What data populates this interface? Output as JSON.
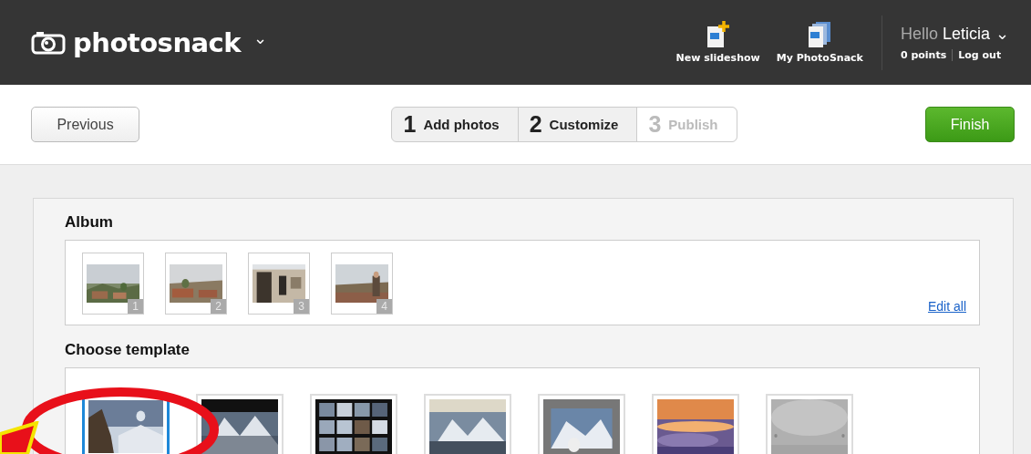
{
  "header": {
    "logo": "photosnack",
    "logo_caret": "⌄",
    "actions": [
      {
        "label": "New slideshow",
        "kind": "new"
      },
      {
        "label": "My PhotoSnack",
        "kind": "stack"
      }
    ],
    "greeting": "Hello",
    "user": "Leticia",
    "user_caret": "⌄",
    "points": "0 points",
    "logout": "Log out"
  },
  "toolbar": {
    "previous": "Previous",
    "finish": "Finish",
    "steps": [
      {
        "number": "1",
        "label": "Add photos",
        "disabled": false
      },
      {
        "number": "2",
        "label": "Customize",
        "disabled": false
      },
      {
        "number": "3",
        "label": "Publish",
        "disabled": true
      }
    ]
  },
  "album": {
    "title": "Album",
    "edit_all": "Edit all",
    "photos": [
      {
        "number": "1"
      },
      {
        "number": "2"
      },
      {
        "number": "3"
      },
      {
        "number": "4"
      }
    ]
  },
  "templates": {
    "title": "Choose template",
    "items": [
      {
        "selected": true
      },
      {
        "selected": false
      },
      {
        "selected": false
      },
      {
        "selected": false
      },
      {
        "selected": false
      },
      {
        "selected": false
      },
      {
        "selected": false
      }
    ]
  }
}
